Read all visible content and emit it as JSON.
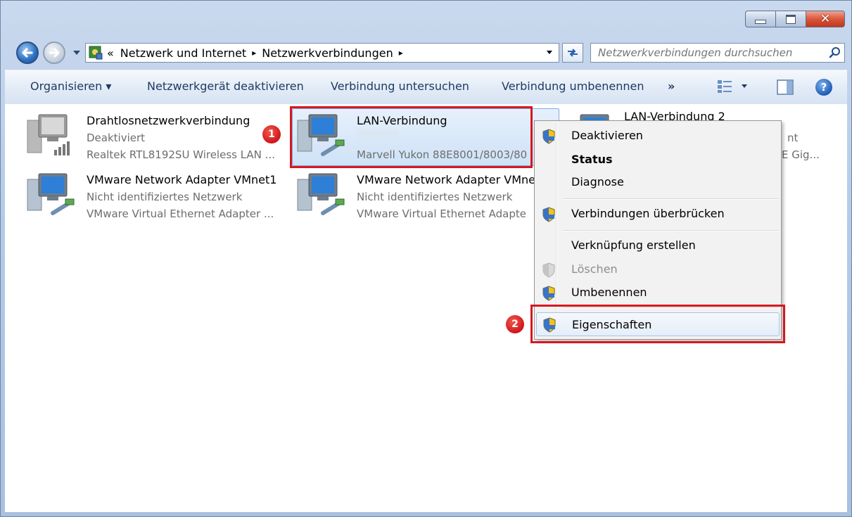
{
  "breadcrumb": {
    "prefix": "«",
    "segments": [
      "Netzwerk und Internet",
      "Netzwerkverbindungen"
    ],
    "separator": "▸"
  },
  "search": {
    "placeholder": "Netzwerkverbindungen durchsuchen"
  },
  "toolbar": {
    "organize": "Organisieren ▾",
    "disable_device": "Netzwerkgerät deaktivieren",
    "diagnose": "Verbindung untersuchen",
    "rename": "Verbindung umbenennen",
    "more": "»"
  },
  "connections": [
    {
      "name": "Drahtlosnetzwerkverbindung",
      "status": "Deaktiviert",
      "device": "Realtek RTL8192SU Wireless LAN ...",
      "icon": "wireless-computer-icon"
    },
    {
      "name": "LAN-Verbindung",
      "status": "",
      "device": "Marvell Yukon 88E8001/8003/80",
      "icon": "lan-computer-icon"
    },
    {
      "name": "LAN-Verbindung 2",
      "status": "nt",
      "device": "E Gig...",
      "icon": "lan-computer-icon"
    },
    {
      "name": "VMware Network Adapter VMnet1",
      "status": "Nicht identifiziertes Netzwerk",
      "device": "VMware Virtual Ethernet Adapter ...",
      "icon": "lan-computer-icon"
    },
    {
      "name": "VMware Network Adapter VMne",
      "status": "Nicht identifiziertes Netzwerk",
      "device": "VMware Virtual Ethernet Adapte",
      "icon": "lan-computer-icon"
    }
  ],
  "context_menu": {
    "items": [
      {
        "label": "Deaktivieren",
        "icon": "uac-shield-icon"
      },
      {
        "label": "Status"
      },
      {
        "label": "Diagnose"
      },
      {
        "label": "Verbindungen überbrücken",
        "icon": "uac-shield-icon"
      },
      {
        "label": "Verknüpfung erstellen"
      },
      {
        "label": "Löschen",
        "icon": "uac-shield-icon",
        "disabled": true
      },
      {
        "label": "Umbenennen",
        "icon": "uac-shield-icon"
      },
      {
        "label": "Eigenschaften",
        "icon": "uac-shield-icon"
      }
    ]
  },
  "annotations": {
    "badge1": "1",
    "badge2": "2"
  },
  "colors": {
    "highlight_red": "#d6181f",
    "selection_blue": "#cfe2f7",
    "toolbar_text": "#1e3a5f"
  }
}
